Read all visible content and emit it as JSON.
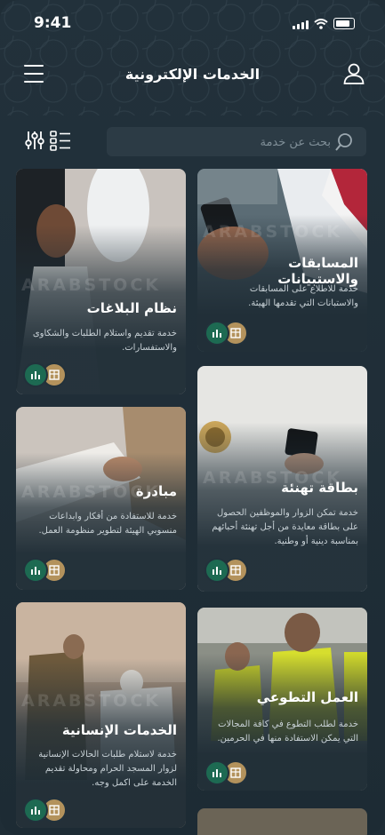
{
  "status": {
    "time": "9:41"
  },
  "header": {
    "title": "الخدمات الإلكترونية"
  },
  "search": {
    "placeholder": "بحث عن خدمة"
  },
  "watermark": "ARABSTOCK",
  "cards": [
    {
      "title": "المسابقات والاستبيانات",
      "description": "خدمة للاطلاع على المسابقات والاستبانات التي تقدمها الهيئة."
    },
    {
      "title": "نظام البلاغات",
      "description": "خدمة تقديم واستلام الطلبات والشكاوى والاستفسارات."
    },
    {
      "title": "بطاقة تهنئة",
      "description": "خدمة تمكن الزوار والموظفين الحصول على بطاقة معايدة من أجل تهنئة أحبائهم بمناسبة دينية أو وطنية."
    },
    {
      "title": "مبادرة",
      "description": "خدمة للاستفادة من أفكار وابداعات منسوبي الهيئة لتطوير منظومة العمل."
    },
    {
      "title": "العمل التطوعي",
      "description": "خدمة لطلب التطوع في كافة المجالات التي يمكن الاستفادة منها في الحرمين."
    },
    {
      "title": "الخدمات الإنسانية",
      "description": "خدمة لاستلام طلبات الحالات الإنسانية لزوار المسجد الحرام ومحاولة تقديم الخدمة على اكمل وجه."
    }
  ],
  "colors": {
    "background": "#1f2d36",
    "badge_green": "#1d6a52",
    "badge_gold": "#b3925c"
  }
}
